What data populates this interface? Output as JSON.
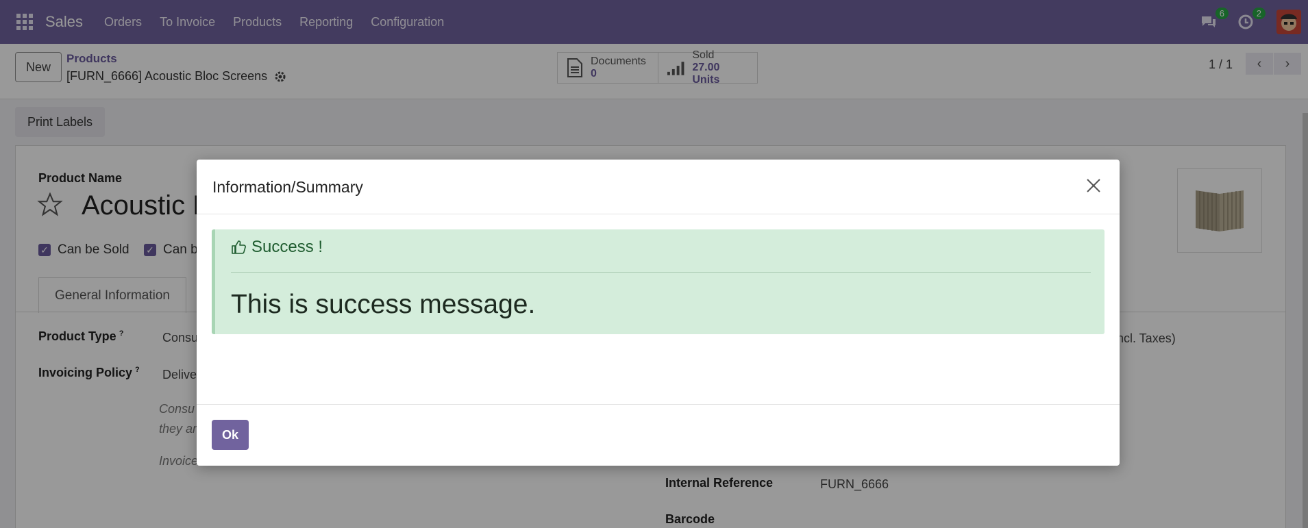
{
  "navbar": {
    "app_name": "Sales",
    "menu": [
      "Orders",
      "To Invoice",
      "Products",
      "Reporting",
      "Configuration"
    ],
    "messages_count": "6",
    "activities_count": "2",
    "accent": "#71639e"
  },
  "control_panel": {
    "new_label": "New",
    "breadcrumb": "Products",
    "record_title": "[FURN_6666] Acoustic Bloc Screens",
    "documents_label": "Documents",
    "documents_value": "0",
    "sold_label": "Sold",
    "sold_value": "27.00 Units",
    "pager": "1 / 1"
  },
  "form": {
    "print_labels": "Print Labels",
    "product_name_label": "Product Name",
    "product_name_value": "Acoustic B",
    "can_be_sold": "Can be Sold",
    "can_be_purchased": "Can b",
    "tab_general": "General Information",
    "product_type_label": "Product Type",
    "product_type_value": "Consu",
    "invoicing_policy_label": "Invoicing Policy",
    "invoicing_policy_value": "Delive",
    "help_1": "Consu",
    "help_2": "they ar",
    "help_3": "Invoice",
    "sales_price_suffix": "ncl. Taxes)",
    "internal_ref_label": "Internal Reference",
    "internal_ref_value": "FURN_6666",
    "barcode_label": "Barcode",
    "help_mark": "?"
  },
  "dialog": {
    "title": "Information/Summary",
    "alert_heading": "Success !",
    "alert_message": "This is success message.",
    "ok_label": "Ok",
    "success_bg": "#d4eddb"
  }
}
